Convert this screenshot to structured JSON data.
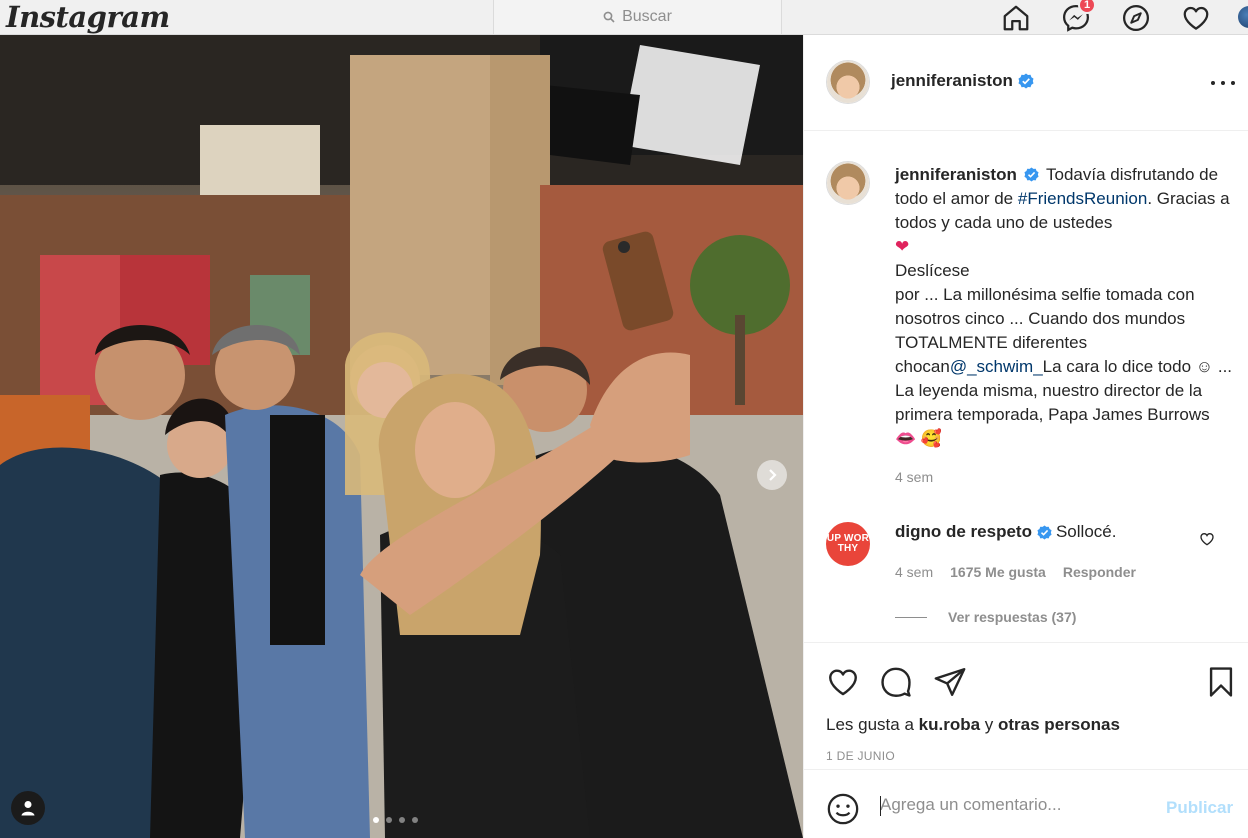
{
  "nav": {
    "logo": "Instagram",
    "search_placeholder": "Buscar",
    "messages_badge": "1",
    "icons": [
      "home-icon",
      "messenger-icon",
      "explore-icon",
      "heart-icon",
      "profile-avatar"
    ]
  },
  "post": {
    "author": "jenniferaniston",
    "carousel_dots": 4,
    "active_dot": 1,
    "caption": {
      "username": "jenniferaniston",
      "part1": "Todavía disfrutando de todo el amor de",
      "hashtag": "#FriendsReunion",
      "part2": ". Gracias a todos y cada uno de ustedes",
      "line_deslicese": "Deslícese",
      "part3": "por ... La millonésima selfie tomada con nosotros cinco ... Cuando dos mundos TOTALMENTE diferentes chocan",
      "mention": "@_schwim_",
      "part4": "La cara lo dice todo ☺ ... La leyenda misma, nuestro director de la primera temporada, Papa James Burrows",
      "time": "4 sem"
    },
    "comment": {
      "avatar_text": "UP WOR THY",
      "username": "digno de respeto",
      "text": "Sollocé.",
      "time": "4 sem",
      "likes": "1675 Me gusta",
      "reply": "Responder",
      "view_replies": "Ver respuestas (37)"
    },
    "likes_prefix": "Les gusta a",
    "likes_user": "ku.roba",
    "likes_conj": "y",
    "likes_others": "otras personas",
    "date": "1 DE JUNIO",
    "add_comment_placeholder": "Agrega un comentario...",
    "publish": "Publicar"
  },
  "colors": {
    "verified": "#3897f0",
    "link": "#00376b",
    "publish_disabled": "#b2dffc",
    "upworthy": "#e9453a"
  }
}
